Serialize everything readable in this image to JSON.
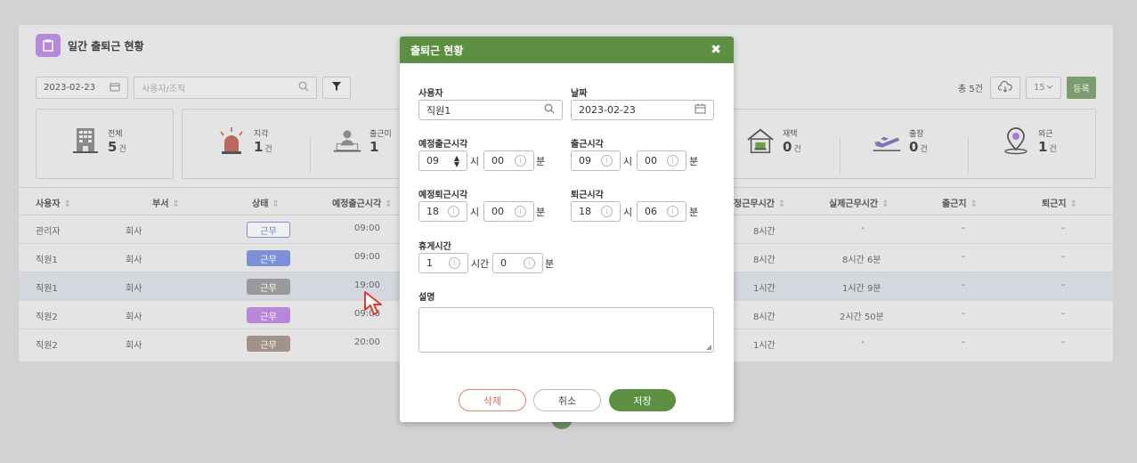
{
  "panel": {
    "title": "일간 출퇴근 현황",
    "date": "2023-02-23",
    "search_placeholder": "사용자/조직",
    "total_count": "총 5건",
    "page_size": "15",
    "register_label": "등록"
  },
  "stats": [
    {
      "label": "전체",
      "value": "5",
      "unit": "건"
    },
    {
      "label": "지각",
      "value": "1",
      "unit": "건"
    },
    {
      "label": "출근미",
      "value": "1",
      "unit": ""
    },
    {
      "label": "재택",
      "value": "0",
      "unit": "건"
    },
    {
      "label": "출장",
      "value": "0",
      "unit": "건"
    },
    {
      "label": "외근",
      "value": "1",
      "unit": "건"
    }
  ],
  "table": {
    "headers": [
      "사용자",
      "부서",
      "상태",
      "예정출근시각",
      "정근무시간",
      "실제근무시간",
      "출근지",
      "퇴근지"
    ],
    "rows": [
      {
        "user": "관리자",
        "dept": "회사",
        "status": "근무",
        "start": "09:00",
        "plan": "8시간",
        "actual": "-",
        "in": "-",
        "out": "-",
        "badge": "outline"
      },
      {
        "user": "직원1",
        "dept": "회사",
        "status": "근무",
        "start": "09:00",
        "plan": "8시간",
        "actual": "8시간 6분",
        "in": "-",
        "out": "-",
        "badge": "blue"
      },
      {
        "user": "직원1",
        "dept": "회사",
        "status": "근무",
        "start": "19:00",
        "plan": "1시간",
        "actual": "1시간 9분",
        "in": "-",
        "out": "-",
        "badge": "gray"
      },
      {
        "user": "직원2",
        "dept": "회사",
        "status": "근무",
        "start": "09:00",
        "plan": "8시간",
        "actual": "2시간 50분",
        "in": "-",
        "out": "-",
        "badge": "purple"
      },
      {
        "user": "직원2",
        "dept": "회사",
        "status": "근무",
        "start": "20:00",
        "plan": "1시간",
        "actual": "-",
        "in": "-",
        "out": "-",
        "badge": "brown"
      }
    ]
  },
  "modal": {
    "title": "출퇴근 현황",
    "user_label": "사용자",
    "user_value": "직원1",
    "date_label": "날짜",
    "date_value": "2023-02-23",
    "planned_start_label": "예정출근시각",
    "planned_start_hour": "09",
    "planned_start_min": "00",
    "start_label": "출근시각",
    "start_hour": "09",
    "start_min": "00",
    "planned_end_label": "예정퇴근시각",
    "planned_end_hour": "18",
    "planned_end_min": "00",
    "end_label": "퇴근시각",
    "end_hour": "18",
    "end_min": "06",
    "break_label": "휴게시간",
    "break_hour": "1",
    "break_min": "0",
    "desc_label": "설명",
    "unit_hour": "시",
    "unit_min": "분",
    "unit_hours": "시간",
    "delete_label": "삭제",
    "cancel_label": "취소",
    "save_label": "저장"
  },
  "colors": {
    "accent": "#5d8f43",
    "badge_blue": "#7d8fd6",
    "badge_gray": "#9a9a9a",
    "badge_purple": "#b888d8",
    "badge_brown": "#a39288",
    "delete": "#e06a5f"
  }
}
